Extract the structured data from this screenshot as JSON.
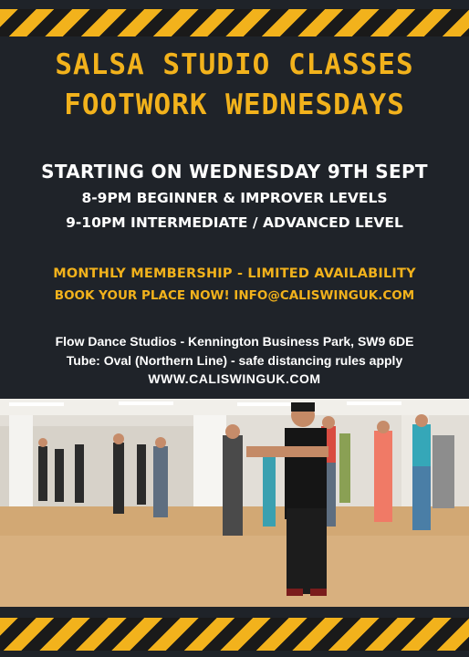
{
  "poster": {
    "title_line1": "SALSA STUDIO CLASSES",
    "title_line2": "FOOTWORK WEDNESDAYS",
    "start_line": "STARTING ON WEDNESDAY 9TH SEPT",
    "level_line1": "8-9PM BEGINNER & IMPROVER LEVELS",
    "level_line2": "9-10PM INTERMEDIATE / ADVANCED LEVEL",
    "membership": "MONTHLY MEMBERSHIP - LIMITED AVAILABILITY",
    "booking": "BOOK YOUR PLACE NOW! INFO@CALISWINGUK.COM",
    "venue": "Flow Dance Studios - Kennington Business Park, SW9 6DE",
    "tube": "Tube: Oval (Northern Line) - safe distancing rules apply",
    "website": "WWW.CALISWINGUK.COM"
  },
  "colors": {
    "background": "#1f2329",
    "accent": "#f2b21c",
    "text": "#ffffff"
  }
}
